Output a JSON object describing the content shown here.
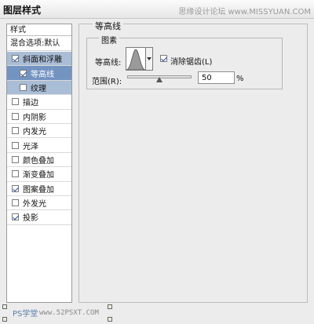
{
  "window": {
    "title": "图层样式"
  },
  "watermark": "思缘设计论坛 www.MISSYUAN.COM",
  "sidebar": {
    "header": "样式",
    "blend_options": "混合选项:默认",
    "effects": [
      {
        "label": "斜面和浮雕",
        "checked": true
      },
      {
        "label": "等高线",
        "checked": true
      },
      {
        "label": "纹理",
        "checked": false
      },
      {
        "label": "描边",
        "checked": false
      },
      {
        "label": "内阴影",
        "checked": false
      },
      {
        "label": "内发光",
        "checked": false
      },
      {
        "label": "光泽",
        "checked": false
      },
      {
        "label": "颜色叠加",
        "checked": false
      },
      {
        "label": "渐变叠加",
        "checked": false
      },
      {
        "label": "图案叠加",
        "checked": true
      },
      {
        "label": "外发光",
        "checked": false
      },
      {
        "label": "投影",
        "checked": true
      }
    ]
  },
  "contour_panel": {
    "section_title": "等高线",
    "group_title": "图素",
    "contour_label": "等高线:",
    "anti_alias_label": "消除锯齿(L)",
    "anti_alias_checked": true,
    "range_label": "范围(R):",
    "range_value": "50",
    "range_unit": "%",
    "range_percent": 50
  },
  "footer": {
    "left_text": "PS学堂",
    "right_text": "www.52PSXT.COM"
  },
  "colors": {
    "selected_row": "#7393c1",
    "child_row": "#a9bdd6",
    "check_mark": "#2a4f9a",
    "window_bg": "#ececec"
  }
}
